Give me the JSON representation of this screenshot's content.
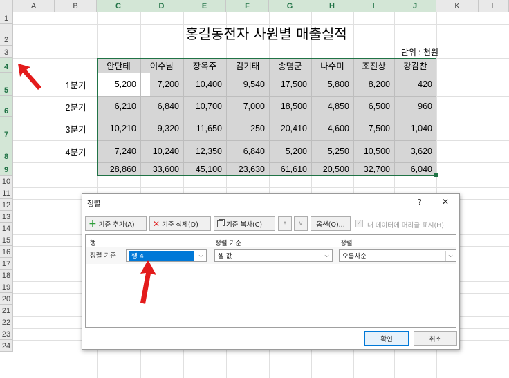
{
  "columns": [
    "A",
    "B",
    "C",
    "D",
    "E",
    "F",
    "G",
    "H",
    "I",
    "J",
    "K",
    "L"
  ],
  "rows": [
    "1",
    "2",
    "3",
    "4",
    "5",
    "6",
    "7",
    "8",
    "9",
    "10",
    "11",
    "12",
    "13",
    "14",
    "15",
    "16",
    "17",
    "18",
    "19",
    "20",
    "21",
    "22",
    "23",
    "24"
  ],
  "title": "홍길동전자 사원별 매출실적",
  "unit": "단위 : 천원",
  "names": [
    "안단테",
    "이수남",
    "장옥주",
    "김기태",
    "송명군",
    "나수미",
    "조진상",
    "강감찬"
  ],
  "quarters": [
    "1분기",
    "2분기",
    "3분기",
    "4분기"
  ],
  "values": [
    [
      "5,200",
      "7,200",
      "10,400",
      "9,540",
      "17,500",
      "5,800",
      "8,200",
      "420"
    ],
    [
      "6,210",
      "6,840",
      "10,700",
      "7,000",
      "18,500",
      "4,850",
      "6,500",
      "960"
    ],
    [
      "10,210",
      "9,320",
      "11,650",
      "250",
      "20,410",
      "4,600",
      "7,500",
      "1,040"
    ],
    [
      "7,240",
      "10,240",
      "12,350",
      "6,840",
      "5,200",
      "5,250",
      "10,500",
      "3,620"
    ]
  ],
  "totals": [
    "28,860",
    "33,600",
    "45,100",
    "23,630",
    "61,610",
    "20,500",
    "32,700",
    "6,040"
  ],
  "dialog": {
    "title": "정렬",
    "help": "?",
    "close": "✕",
    "add_label": "기준 추가(A)",
    "delete_label": "기준 삭제(D)",
    "copy_label": "기준 복사(C)",
    "up": "∧",
    "down": "∨",
    "options_label": "옵션(O)...",
    "header_checkbox_label": "내 데이터에 머리글 표시(H)",
    "col_header_row": "행",
    "col_header_sorton": "정렬 기준",
    "col_header_order": "정렬",
    "criteria_label": "정렬 기준",
    "row_value": "행 4",
    "sorton_value": "셀 값",
    "order_value": "오름차순",
    "ok_label": "확인",
    "cancel_label": "취소"
  },
  "colors": {
    "accent": "#217346",
    "arrow": "#e31b1b",
    "selection": "#0078d7"
  }
}
